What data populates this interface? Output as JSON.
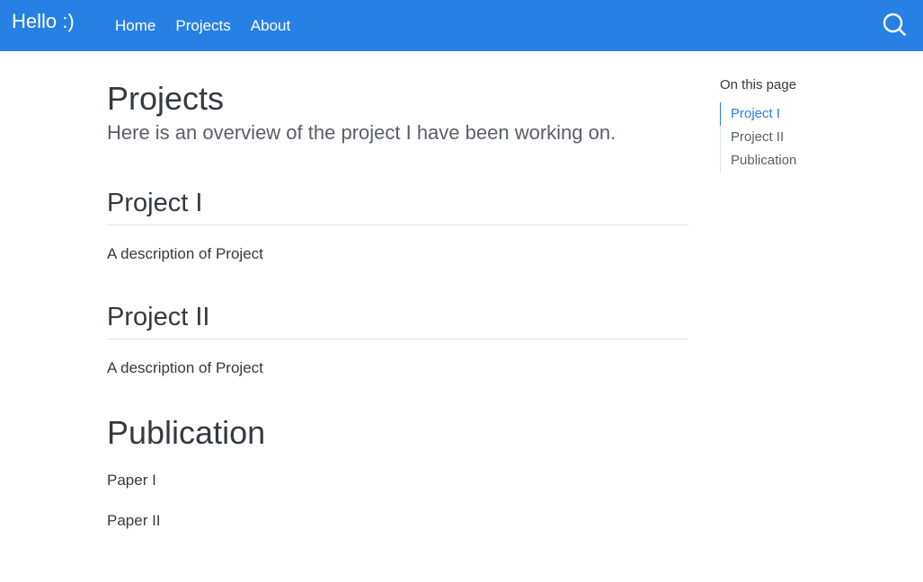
{
  "navbar": {
    "brand": "Hello :)",
    "links": [
      {
        "label": "Home"
      },
      {
        "label": "Projects"
      },
      {
        "label": "About"
      }
    ],
    "search_icon": "search-icon"
  },
  "main": {
    "title": "Projects",
    "subtitle": "Here is an overview of the project I have been working on.",
    "sections": [
      {
        "heading": "Project I",
        "text": "A description of Project"
      },
      {
        "heading": "Project II",
        "text": "A description of Project"
      }
    ],
    "publication": {
      "heading": "Publication",
      "papers": [
        "Paper I",
        "Paper II"
      ]
    }
  },
  "toc": {
    "title": "On this page",
    "items": [
      {
        "label": "Project I",
        "active": true
      },
      {
        "label": "Project II",
        "active": false
      },
      {
        "label": "Publication",
        "active": false
      }
    ]
  },
  "colors": {
    "navbar_bg": "#2780e3",
    "accent": "#2780e3",
    "text": "#343a40",
    "muted": "#595f65",
    "divider": "#dee2e6"
  }
}
